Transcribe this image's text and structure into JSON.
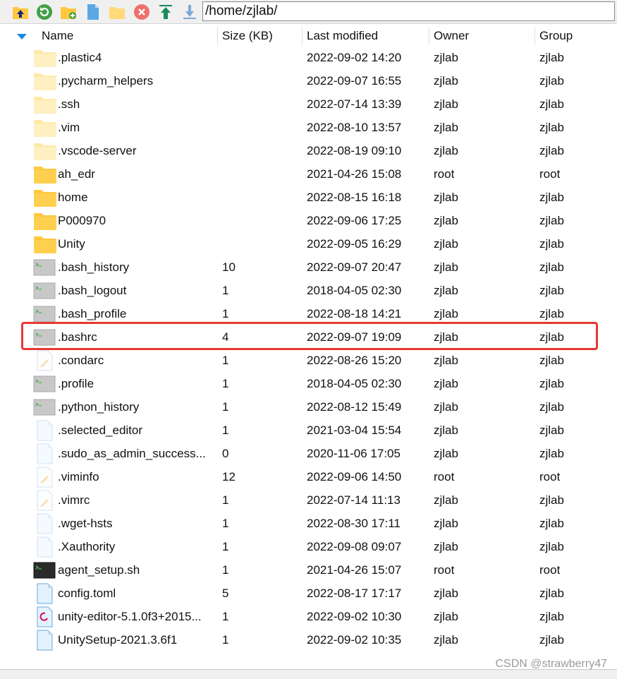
{
  "toolbar": {
    "buttons": [
      {
        "name": "parent-folder-button",
        "icon": "folder-up-icon"
      },
      {
        "name": "refresh-button",
        "icon": "refresh-icon"
      },
      {
        "name": "new-folder-button",
        "icon": "new-folder-icon"
      },
      {
        "name": "new-file-button",
        "icon": "new-file-icon"
      },
      {
        "name": "open-folder-button",
        "icon": "folder-icon"
      },
      {
        "name": "delete-button",
        "icon": "delete-icon"
      },
      {
        "name": "upload-button",
        "icon": "upload-icon"
      },
      {
        "name": "download-button",
        "icon": "download-icon"
      }
    ],
    "path": "/home/zjlab/"
  },
  "columns": {
    "name": "Name",
    "size": "Size (KB)",
    "modified": "Last modified",
    "owner": "Owner",
    "group": "Group"
  },
  "files": [
    {
      "name": ".plastic4",
      "size": "",
      "modified": "2022-09-02 14:20",
      "owner": "zjlab",
      "group": "zjlab",
      "type": "folder-hidden"
    },
    {
      "name": ".pycharm_helpers",
      "size": "",
      "modified": "2022-09-07 16:55",
      "owner": "zjlab",
      "group": "zjlab",
      "type": "folder-hidden"
    },
    {
      "name": ".ssh",
      "size": "",
      "modified": "2022-07-14 13:39",
      "owner": "zjlab",
      "group": "zjlab",
      "type": "folder-hidden"
    },
    {
      "name": ".vim",
      "size": "",
      "modified": "2022-08-10 13:57",
      "owner": "zjlab",
      "group": "zjlab",
      "type": "folder-hidden"
    },
    {
      "name": ".vscode-server",
      "size": "",
      "modified": "2022-08-19 09:10",
      "owner": "zjlab",
      "group": "zjlab",
      "type": "folder-hidden"
    },
    {
      "name": "ah_edr",
      "size": "",
      "modified": "2021-04-26 15:08",
      "owner": "root",
      "group": "root",
      "type": "folder"
    },
    {
      "name": "home",
      "size": "",
      "modified": "2022-08-15 16:18",
      "owner": "zjlab",
      "group": "zjlab",
      "type": "folder"
    },
    {
      "name": "P000970",
      "size": "",
      "modified": "2022-09-06 17:25",
      "owner": "zjlab",
      "group": "zjlab",
      "type": "folder"
    },
    {
      "name": "Unity",
      "size": "",
      "modified": "2022-09-05 16:29",
      "owner": "zjlab",
      "group": "zjlab",
      "type": "folder"
    },
    {
      "name": ".bash_history",
      "size": "10",
      "modified": "2022-09-07 20:47",
      "owner": "zjlab",
      "group": "zjlab",
      "type": "shell-hidden"
    },
    {
      "name": ".bash_logout",
      "size": "1",
      "modified": "2018-04-05 02:30",
      "owner": "zjlab",
      "group": "zjlab",
      "type": "shell-hidden"
    },
    {
      "name": ".bash_profile",
      "size": "1",
      "modified": "2022-08-18 14:21",
      "owner": "zjlab",
      "group": "zjlab",
      "type": "shell-hidden"
    },
    {
      "name": ".bashrc",
      "size": "4",
      "modified": "2022-09-07 19:09",
      "owner": "zjlab",
      "group": "zjlab",
      "type": "shell-hidden"
    },
    {
      "name": ".condarc",
      "size": "1",
      "modified": "2022-08-26 15:20",
      "owner": "zjlab",
      "group": "zjlab",
      "type": "text-hidden"
    },
    {
      "name": ".profile",
      "size": "1",
      "modified": "2018-04-05 02:30",
      "owner": "zjlab",
      "group": "zjlab",
      "type": "shell-hidden"
    },
    {
      "name": ".python_history",
      "size": "1",
      "modified": "2022-08-12 15:49",
      "owner": "zjlab",
      "group": "zjlab",
      "type": "shell-hidden"
    },
    {
      "name": ".selected_editor",
      "size": "1",
      "modified": "2021-03-04 15:54",
      "owner": "zjlab",
      "group": "zjlab",
      "type": "file-hidden"
    },
    {
      "name": ".sudo_as_admin_success...",
      "size": "0",
      "modified": "2020-11-06 17:05",
      "owner": "zjlab",
      "group": "zjlab",
      "type": "file-hidden"
    },
    {
      "name": ".viminfo",
      "size": "12",
      "modified": "2022-09-06 14:50",
      "owner": "root",
      "group": "root",
      "type": "text-hidden"
    },
    {
      "name": ".vimrc",
      "size": "1",
      "modified": "2022-07-14 11:13",
      "owner": "zjlab",
      "group": "zjlab",
      "type": "text-hidden"
    },
    {
      "name": ".wget-hsts",
      "size": "1",
      "modified": "2022-08-30 17:11",
      "owner": "zjlab",
      "group": "zjlab",
      "type": "file-hidden"
    },
    {
      "name": ".Xauthority",
      "size": "1",
      "modified": "2022-09-08 09:07",
      "owner": "zjlab",
      "group": "zjlab",
      "type": "file-hidden"
    },
    {
      "name": "agent_setup.sh",
      "size": "1",
      "modified": "2021-04-26 15:07",
      "owner": "root",
      "group": "root",
      "type": "shell"
    },
    {
      "name": "config.toml",
      "size": "5",
      "modified": "2022-08-17 17:17",
      "owner": "zjlab",
      "group": "zjlab",
      "type": "file"
    },
    {
      "name": "unity-editor-5.1.0f3+2015...",
      "size": "1",
      "modified": "2022-09-02 10:30",
      "owner": "zjlab",
      "group": "zjlab",
      "type": "debian"
    },
    {
      "name": "UnitySetup-2021.3.6f1",
      "size": "1",
      "modified": "2022-09-02 10:35",
      "owner": "zjlab",
      "group": "zjlab",
      "type": "file"
    }
  ],
  "highlighted_row": ".bashrc",
  "colors": {
    "folder": "#ffc83d",
    "folder_hidden": "#ffe9a8",
    "highlight": "#e53935",
    "sort_arrow": "#1e88e5"
  },
  "watermark": "CSDN @strawberry47"
}
